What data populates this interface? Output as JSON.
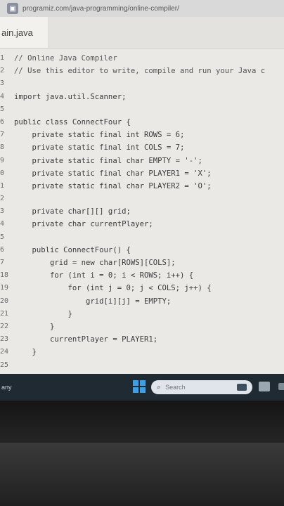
{
  "browser": {
    "url": "programiz.com/java-programming/online-compiler/"
  },
  "editor": {
    "tab": "ain.java",
    "lines": [
      {
        "num": "1",
        "text": "// Online Java Compiler",
        "color": "#555555"
      },
      {
        "num": "2",
        "text": "// Use this editor to write, compile and run your Java c",
        "color": "#555555"
      },
      {
        "num": "3",
        "text": "",
        "color": "#3b3b3b"
      },
      {
        "num": "4",
        "text": "import java.util.Scanner;",
        "color": "#3b3b3b"
      },
      {
        "num": "5",
        "text": "",
        "color": "#3b3b3b"
      },
      {
        "num": "6",
        "text": "public class ConnectFour {",
        "color": "#3b3b3b"
      },
      {
        "num": "7",
        "text": "    private static final int ROWS = 6;",
        "color": "#3b3b3b"
      },
      {
        "num": "8",
        "text": "    private static final int COLS = 7;",
        "color": "#3b3b3b"
      },
      {
        "num": "9",
        "text": "    private static final char EMPTY = '-';",
        "color": "#3b3b3b"
      },
      {
        "num": "0",
        "text": "    private static final char PLAYER1 = 'X';",
        "color": "#3b3b3b"
      },
      {
        "num": "1",
        "text": "    private static final char PLAYER2 = 'O';",
        "color": "#3b3b3b"
      },
      {
        "num": "2",
        "text": "",
        "color": "#3b3b3b"
      },
      {
        "num": "3",
        "text": "    private char[][] grid;",
        "color": "#3b3b3b"
      },
      {
        "num": "4",
        "text": "    private char currentPlayer;",
        "color": "#3b3b3b"
      },
      {
        "num": "5",
        "text": "",
        "color": "#3b3b3b"
      },
      {
        "num": "6",
        "text": "    public ConnectFour() {",
        "color": "#3b3b3b"
      },
      {
        "num": "7",
        "text": "        grid = new char[ROWS][COLS];",
        "color": "#3b3b3b"
      },
      {
        "num": "18",
        "text": "        for (int i = 0; i < ROWS; i++) {",
        "color": "#3b3b3b"
      },
      {
        "num": "19",
        "text": "            for (int j = 0; j < COLS; j++) {",
        "color": "#3b3b3b"
      },
      {
        "num": "20",
        "text": "                grid[i][j] = EMPTY;",
        "color": "#3b3b3b"
      },
      {
        "num": "21",
        "text": "            }",
        "color": "#3b3b3b"
      },
      {
        "num": "22",
        "text": "        }",
        "color": "#3b3b3b"
      },
      {
        "num": "23",
        "text": "        currentPlayer = PLAYER1;",
        "color": "#3b3b3b"
      },
      {
        "num": "24",
        "text": "    }",
        "color": "#3b3b3b"
      },
      {
        "num": "25",
        "text": "",
        "color": "#3b3b3b"
      }
    ]
  },
  "taskbar": {
    "left_label": "any",
    "search_placeholder": "Search"
  }
}
